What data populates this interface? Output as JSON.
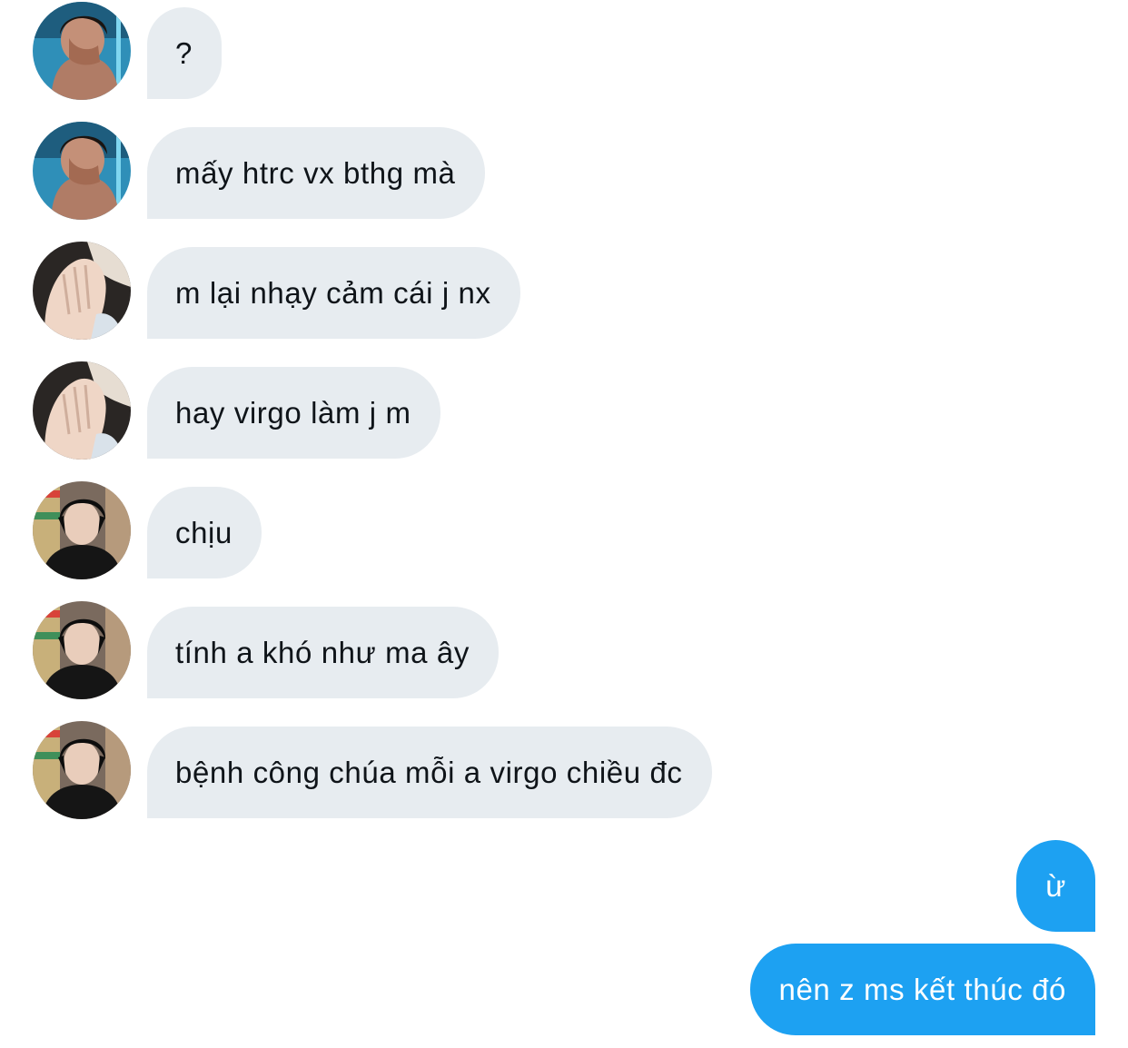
{
  "conversation": {
    "messages": [
      {
        "text": "?",
        "avatar": "avatar-pool-boy"
      },
      {
        "text": "mấy htrc vx bthg mà",
        "avatar": "avatar-pool-boy"
      },
      {
        "text": "m lại nhạy cảm cái j nx",
        "avatar": "avatar-hand-face"
      },
      {
        "text": "hay virgo làm j m",
        "avatar": "avatar-hand-face"
      },
      {
        "text": "chịu",
        "avatar": "avatar-black-hoodie"
      },
      {
        "text": "tính a khó như ma ây",
        "avatar": "avatar-black-hoodie"
      },
      {
        "text": "bệnh công chúa mỗi a virgo chiều đc",
        "avatar": "avatar-black-hoodie"
      }
    ],
    "sent": [
      {
        "text": "ừ"
      },
      {
        "text": "nên z ms kết thúc đó"
      }
    ]
  },
  "colors": {
    "incoming_bubble": "#e7ecf0",
    "outgoing_bubble": "#1da1f2",
    "incoming_text": "#0f1419",
    "outgoing_text": "#ffffff"
  }
}
